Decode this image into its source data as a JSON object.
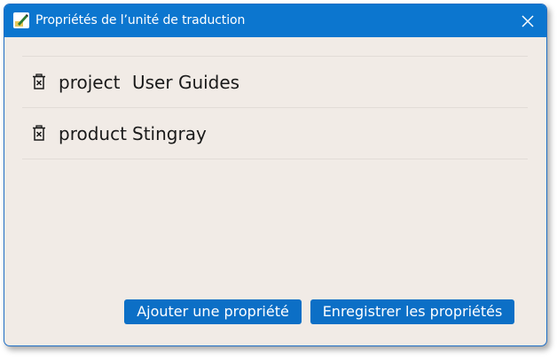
{
  "window": {
    "title": "Propriétés de l’unité de traduction",
    "app_icon": "pen-icon",
    "close_icon": "close-icon"
  },
  "properties": [
    {
      "key": "project",
      "value": "User Guides",
      "delete_icon": "trash-icon"
    },
    {
      "key": "product",
      "value": "Stingray",
      "delete_icon": "trash-icon"
    }
  ],
  "actions": {
    "add_label": "Ajouter une propriété",
    "save_label": "Enregistrer les propriétés"
  },
  "colors": {
    "accent": "#0c76cf",
    "button": "#0c6fc6",
    "background": "#f1ebe6"
  }
}
